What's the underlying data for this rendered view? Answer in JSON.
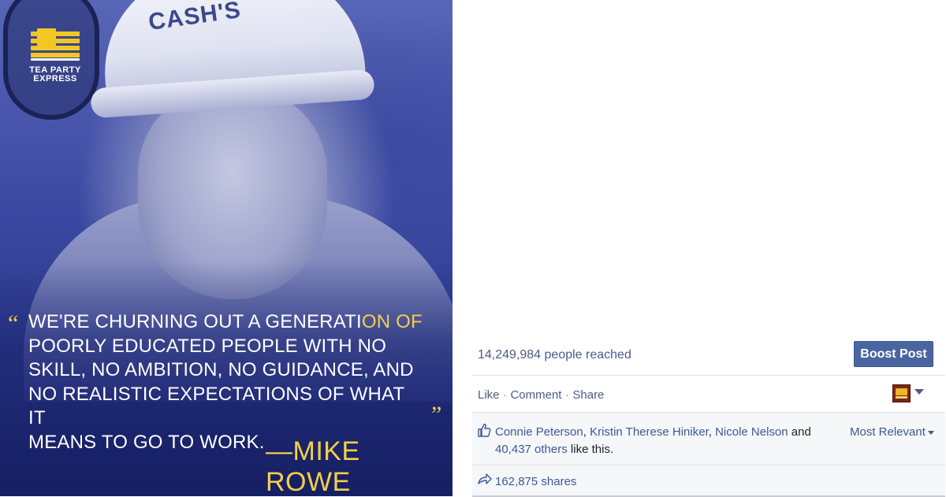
{
  "image": {
    "logo_text": "TEA PARTY EXPRESS",
    "helmet_text": "CASH'S",
    "quote_open": "“",
    "quote_lines": [
      [
        "WE'RE CHURNING OUT A GENERATI",
        "ON OF"
      ],
      [
        "POORLY EDUCATED PEOPLE WITH NO",
        ""
      ],
      [
        "SKILL, NO AMBITION, NO GUIDANCE, AND",
        ""
      ],
      [
        "NO REALISTIC EXPECTATIONS OF WHAT IT",
        ""
      ],
      [
        "MEANS TO GO TO WORK.",
        ""
      ]
    ],
    "quote_close": "”",
    "attribution": "—MIKE ROWE"
  },
  "post": {
    "reach": "14,249,984 people reached",
    "boost_label": "Boost Post",
    "actions": {
      "like": "Like",
      "comment": "Comment",
      "share": "Share",
      "separator": "·"
    },
    "likes": {
      "names": [
        "Connie Peterson",
        "Kristin Therese Hiniker",
        "Nicole Nelson"
      ],
      "separator": ",",
      "and_text": "and",
      "others_link": "40,437 others",
      "suffix": "like this."
    },
    "sort_label": "Most Relevant",
    "shares": "162,875 shares"
  },
  "colors": {
    "link": "#3b5998",
    "boost_bg": "#4a66a0",
    "quote_highlight": "#f3cf4a"
  }
}
